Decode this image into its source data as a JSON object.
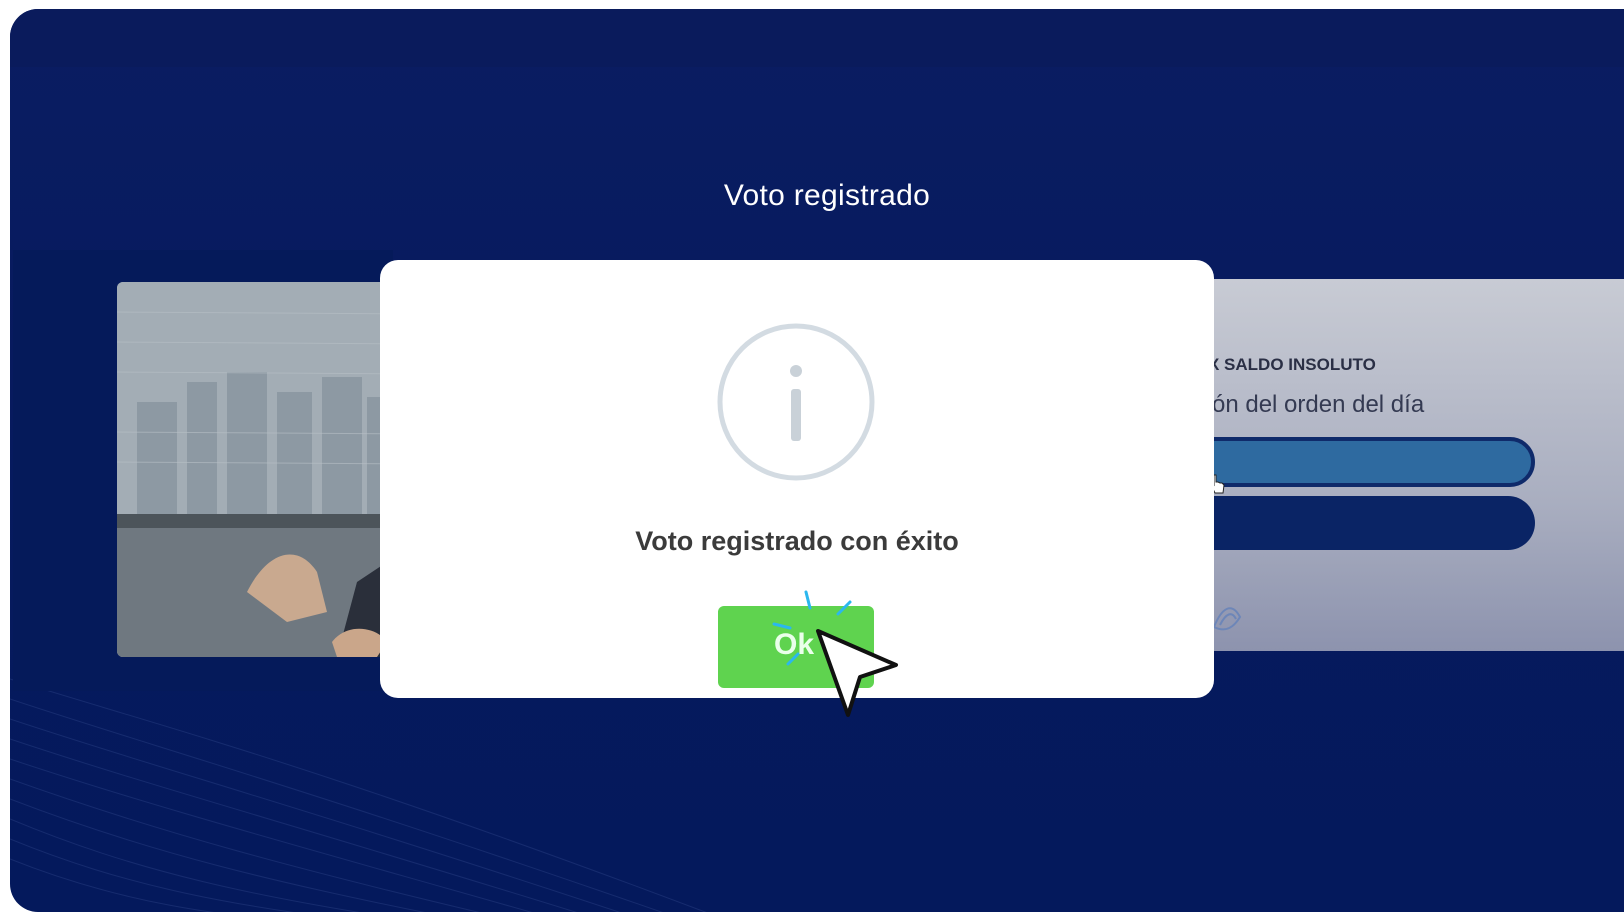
{
  "page": {
    "heading": "Voto registrado"
  },
  "background_cards": {
    "right_label": "X SALDO INSOLUTO",
    "right_subtitle": "ón del orden del día"
  },
  "modal": {
    "icon": "info-circle-icon",
    "message": "Voto registrado con éxito",
    "ok_label": "Ok"
  },
  "colors": {
    "background": "#071a5e",
    "ok_button": "#5fd34f",
    "modal": "#ffffff",
    "info_icon_stroke": "#d3dbe2"
  },
  "cursor": {
    "icon": "arrow-cursor-icon"
  }
}
